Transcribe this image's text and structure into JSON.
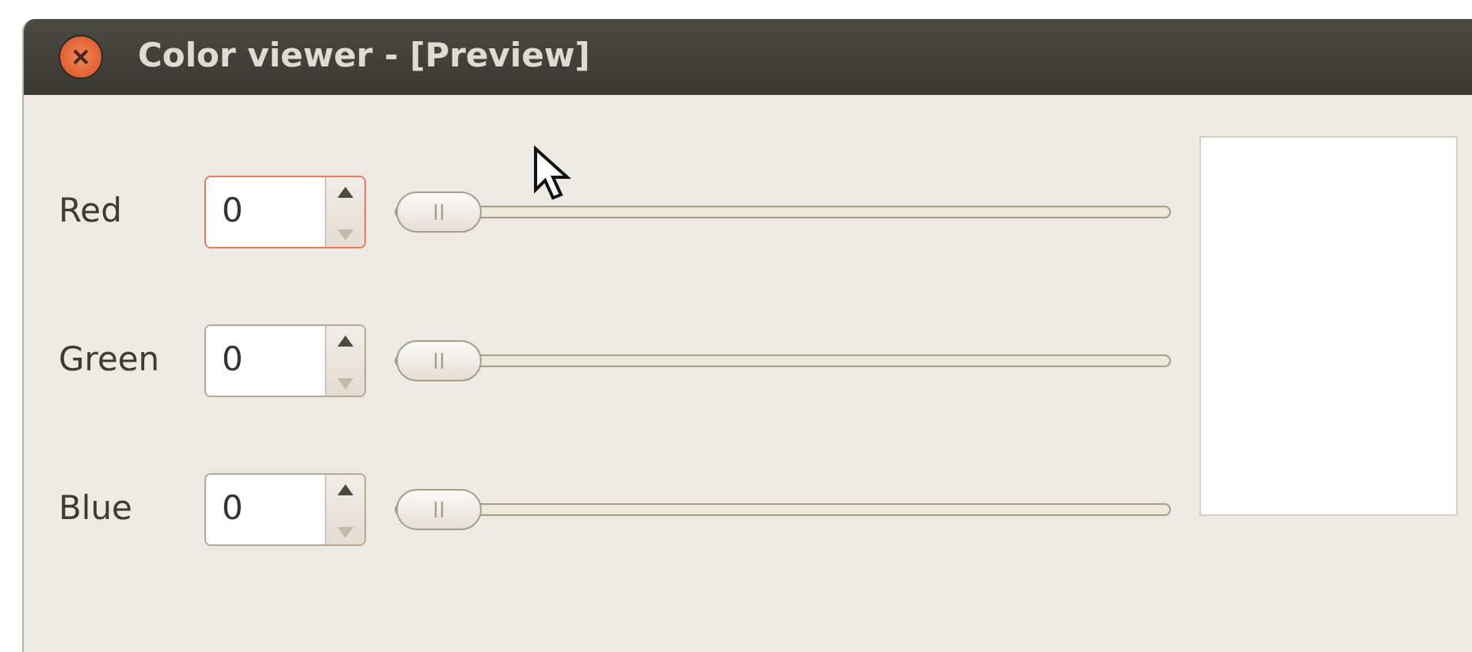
{
  "window": {
    "title": "Color viewer - [Preview]"
  },
  "channels": [
    {
      "label": "Red",
      "value": "0",
      "focused": true,
      "level": 0,
      "can_decrease": false
    },
    {
      "label": "Green",
      "value": "0",
      "focused": false,
      "level": 0,
      "can_decrease": false
    },
    {
      "label": "Blue",
      "value": "0",
      "focused": false,
      "level": 0,
      "can_decrease": false
    }
  ]
}
